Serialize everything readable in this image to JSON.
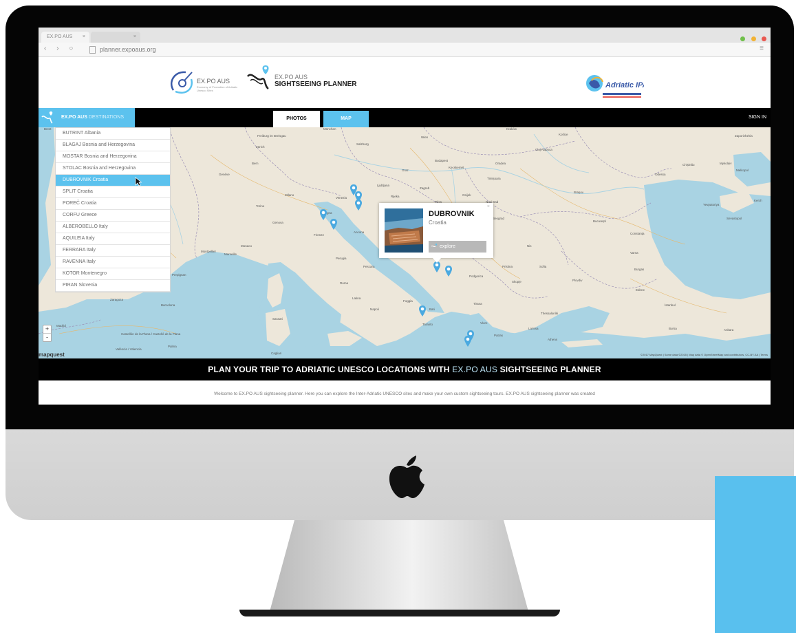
{
  "colors": {
    "accent": "#5cc2ee",
    "bezel": "#050505",
    "chin": "#d4d4d4",
    "navbar": "#000000",
    "map_land": "#ede7da",
    "map_sea": "#a9d3e3",
    "marker": "#4aa9e0"
  },
  "browser": {
    "tab_label": "EX.PO AUS planner",
    "tab_close": "×",
    "tab2_close": "×",
    "nav_buttons": "‹ › ○",
    "url": "planner.expoaus.org",
    "menu_icon": "≡"
  },
  "header": {
    "logo1_title": "EX.PO AUS",
    "logo1_subtitle": "Economy of Promotion of Adriatic Unesco Sites",
    "logo2_line1": "EX.PO AUS",
    "logo2_line2": "SIGHTSEEING PLANNER",
    "logo3_text": "Adriatic IPA"
  },
  "navbar": {
    "brand_bold": "EX.PO AUS",
    "brand_thin": "DESTINATIONS",
    "photos": "PHOTOS",
    "map": "MAP",
    "sign_in": "SIGN IN"
  },
  "destinations": [
    "BUTRINT Albania",
    "BLAGAJ Bosnia and Herzegovina",
    "MOSTAR Bosnia and Herzegovina",
    "STOLAC Bosnia and Herzegovina",
    "DUBROVNIK Croatia",
    "SPLIT Croatia",
    "POREČ Croatia",
    "CORFU Greece",
    "ALBEROBELLO Italy",
    "AQUILEIA Italy",
    "FERRARA Italy",
    "RAVENNA Italy",
    "KOTOR Montenegro",
    "PIRAN Slovenia"
  ],
  "active_destination_index": 4,
  "popup": {
    "title": "DUBROVNIK",
    "country": "Croatia",
    "button": "explore",
    "close": "×"
  },
  "map": {
    "zoom_in": "+",
    "zoom_out": "-",
    "attribution": "mapquest",
    "credits": "©2017 MapQuest | Some data ©2015 | Map data © OpenStreetMap and contributors, CC-BY-SA | Terms",
    "cities": [
      "Brest",
      "Freiburg im Breisgau",
      "München",
      "Salzburg",
      "Zürich",
      "Bern",
      "Genève",
      "Wien",
      "Budapest",
      "Graz",
      "Ljubljana",
      "Zagreb",
      "Venezia",
      "Milano",
      "Torino",
      "Genova",
      "Monaco",
      "Bologna",
      "Firenze",
      "Ancona",
      "Marseille",
      "Montpellier",
      "Perpignan",
      "Barcelona",
      "Zaragoza",
      "Madrid",
      "Castellón de la Plana / Castelló de la Plana",
      "València / Valencia",
      "Palma",
      "Roma",
      "Napoli",
      "Foggia",
      "Bari",
      "Taranto",
      "Sassari",
      "Cagliari",
      "Sarajevo",
      "Beograd",
      "Novi Sad",
      "Timișoara",
      "Cluj-Napoca",
      "Brașov",
      "București",
      "Constanța",
      "Varna",
      "Burgas",
      "Sofia",
      "Plovdiv",
      "Podgorica",
      "Skopje",
      "Pristina",
      "Tirana",
      "Vlore",
      "Thessaloníki",
      "İstanbul",
      "Edirne",
      "Bursa",
      "Ankara",
      "Chișinău",
      "Odessa",
      "Mykolaiv",
      "Melitopol",
      "Sevastopol",
      "Yevpatoriya",
      "Zaporizhzhia",
      "Larissa",
      "Patras",
      "Athens",
      "Kraków",
      "Košice",
      "Oradea",
      "Kecskemét",
      "Pécs",
      "Split",
      "Perugia",
      "Latina",
      "Pescara",
      "Rijeka",
      "Osijek",
      "Nis",
      "Kerch"
    ]
  },
  "banner": {
    "part1": "PLAN YOUR TRIP TO ADRIATIC UNESCO LOCATIONS WITH",
    "part2": "EX.PO AUS",
    "part3": "SIGHTSEEING PLANNER"
  },
  "welcome_text": "Welcome to EX.PO AUS sightseeing planner. Here you can explore the Inter-Adriatic UNESCO sites and make your own custom sightseeing tours.   EX.PO AUS sightseeing planner was created"
}
